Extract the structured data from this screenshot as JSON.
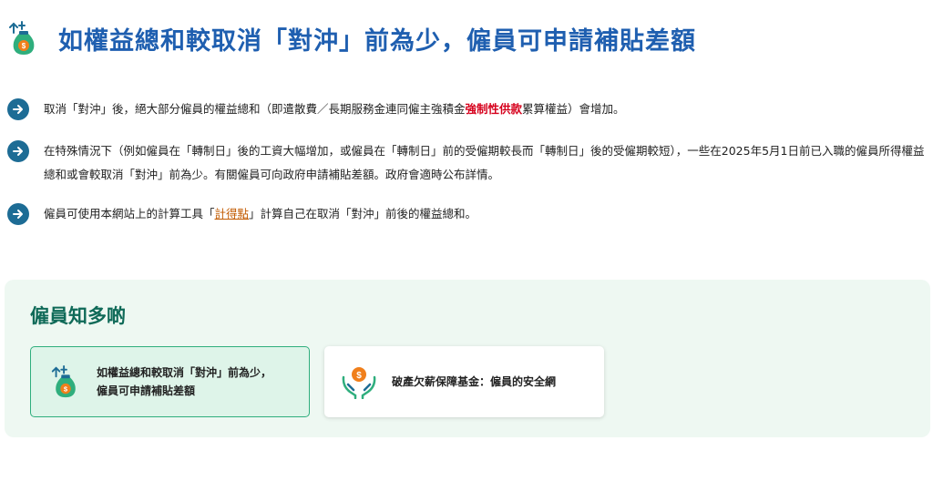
{
  "header": {
    "title": "如權益總和較取消「對沖」前為少，僱員可申請補貼差額"
  },
  "bullets": [
    {
      "pre": "取消「對沖」後，絕大部分僱員的權益總和（即遣散費／長期服務金連同僱主強積金",
      "highlight": "強制性供款",
      "post": "累算權益）會增加。"
    },
    {
      "text": "在特殊情況下（例如僱員在「轉制日」後的工資大幅增加，或僱員在「轉制日」前的受僱期較長而「轉制日」後的受僱期較短），一些在2025年5月1日前已入職的僱員所得權益總和或會較取消「對沖」前為少。有關僱員可向政府申請補貼差額。政府會適時公布詳情。"
    },
    {
      "pre": "僱員可使用本網站上的計算工具「",
      "link": "計得點",
      "post": "」計算自己在取消「對沖」前後的權益總和。"
    }
  ],
  "panel": {
    "title": "僱員知多啲",
    "cards": [
      {
        "label": "如權益總和較取消「對沖」前為少，僱員可申請補貼差額"
      },
      {
        "label": "破產欠薪保障基金：僱員的安全網"
      }
    ]
  },
  "colors": {
    "title": "#1f5fb0",
    "accent_green": "#0f6a58",
    "arrow": "#1d6c95",
    "highlight_red": "#d6001c",
    "link": "#c25a00"
  }
}
